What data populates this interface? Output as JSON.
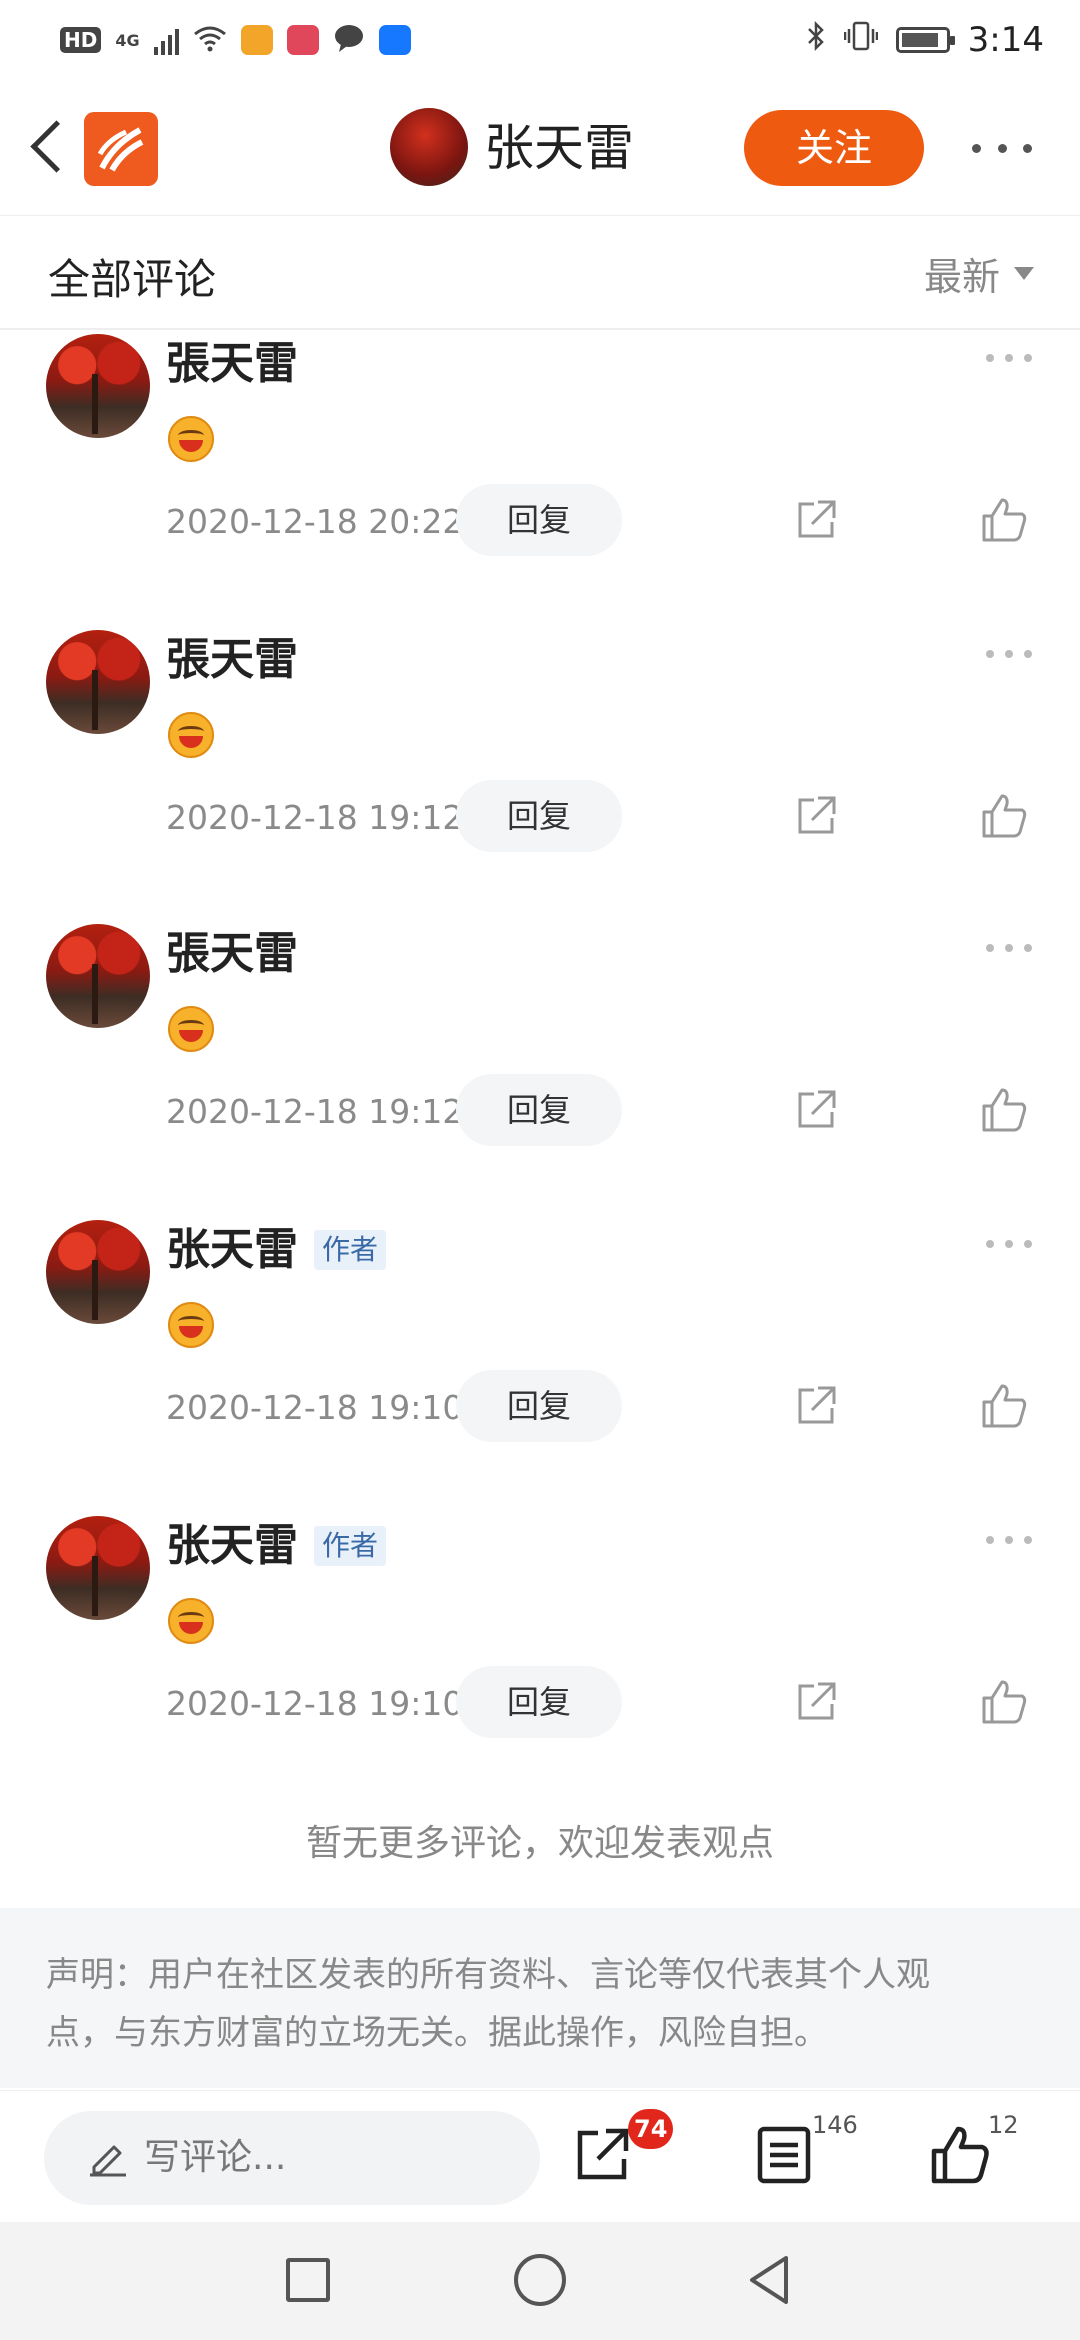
{
  "status_bar": {
    "left_badge": "HD",
    "network": "4G",
    "time": "3:14"
  },
  "header": {
    "user_name": "张天雷",
    "follow_label": "关注"
  },
  "section": {
    "title": "全部评论",
    "sort_label": "最新"
  },
  "comments": [
    {
      "name": "張天雷",
      "is_author": false,
      "tag": "",
      "time": "2020-12-18 20:22",
      "reply_label": "回复"
    },
    {
      "name": "張天雷",
      "is_author": false,
      "tag": "",
      "time": "2020-12-18 19:12",
      "reply_label": "回复"
    },
    {
      "name": "張天雷",
      "is_author": false,
      "tag": "",
      "time": "2020-12-18 19:12",
      "reply_label": "回复"
    },
    {
      "name": "张天雷",
      "is_author": true,
      "tag": "作者",
      "time": "2020-12-18 19:10",
      "reply_label": "回复"
    },
    {
      "name": "张天雷",
      "is_author": true,
      "tag": "作者",
      "time": "2020-12-18 19:10",
      "reply_label": "回复"
    }
  ],
  "no_more_text": "暂无更多评论，欢迎发表观点",
  "disclaimer": {
    "line1": "声明：用户在社区发表的所有资料、言论等仅代表其个人观",
    "line2": "点，与东方财富的立场无关。据此操作，风险自担。"
  },
  "bottom_bar": {
    "write_placeholder": "写评论...",
    "share_badge": "74",
    "comments_count": "146",
    "likes_count": "12"
  },
  "colors": {
    "accent": "#ef5a11",
    "badge": "#e1271b",
    "author_tag_text": "#3a6aa6",
    "author_tag_bg": "#e8f0fa"
  }
}
